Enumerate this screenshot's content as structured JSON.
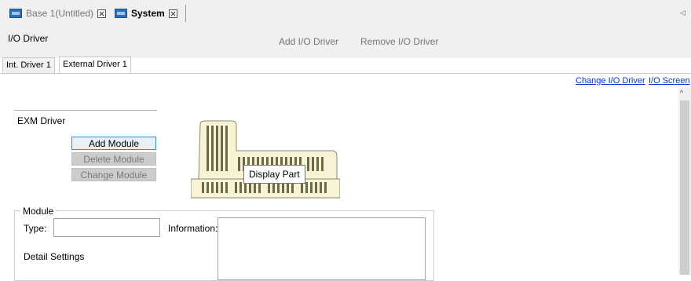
{
  "doc_tabs": [
    {
      "label": "Base 1(Untitled)",
      "active": false
    },
    {
      "label": "System",
      "active": true
    }
  ],
  "header": {
    "title": "I/O Driver",
    "add_driver": "Add I/O Driver",
    "remove_driver": "Remove I/O Driver"
  },
  "driver_tabs": [
    {
      "label": "Int. Driver 1",
      "active": false
    },
    {
      "label": "External Driver 1",
      "active": true
    }
  ],
  "links": {
    "change_driver": "Change I/O Driver",
    "io_screen": "I/O Screen"
  },
  "exm": {
    "title": "EXM Driver",
    "add_module": "Add Module",
    "delete_module": "Delete Module",
    "change_module": "Change Module",
    "tooltip": "Display Part"
  },
  "module_group": {
    "legend": "Module",
    "type_label": "Type:",
    "type_value": "",
    "info_label": "Information:",
    "info_value": "",
    "detail_label": "Detail Settings"
  },
  "colors": {
    "link": "#0033cc",
    "button_hover_border": "#3a8ad6",
    "module_fill": "#f7f3d4",
    "module_slot": "#6b6b4a"
  }
}
